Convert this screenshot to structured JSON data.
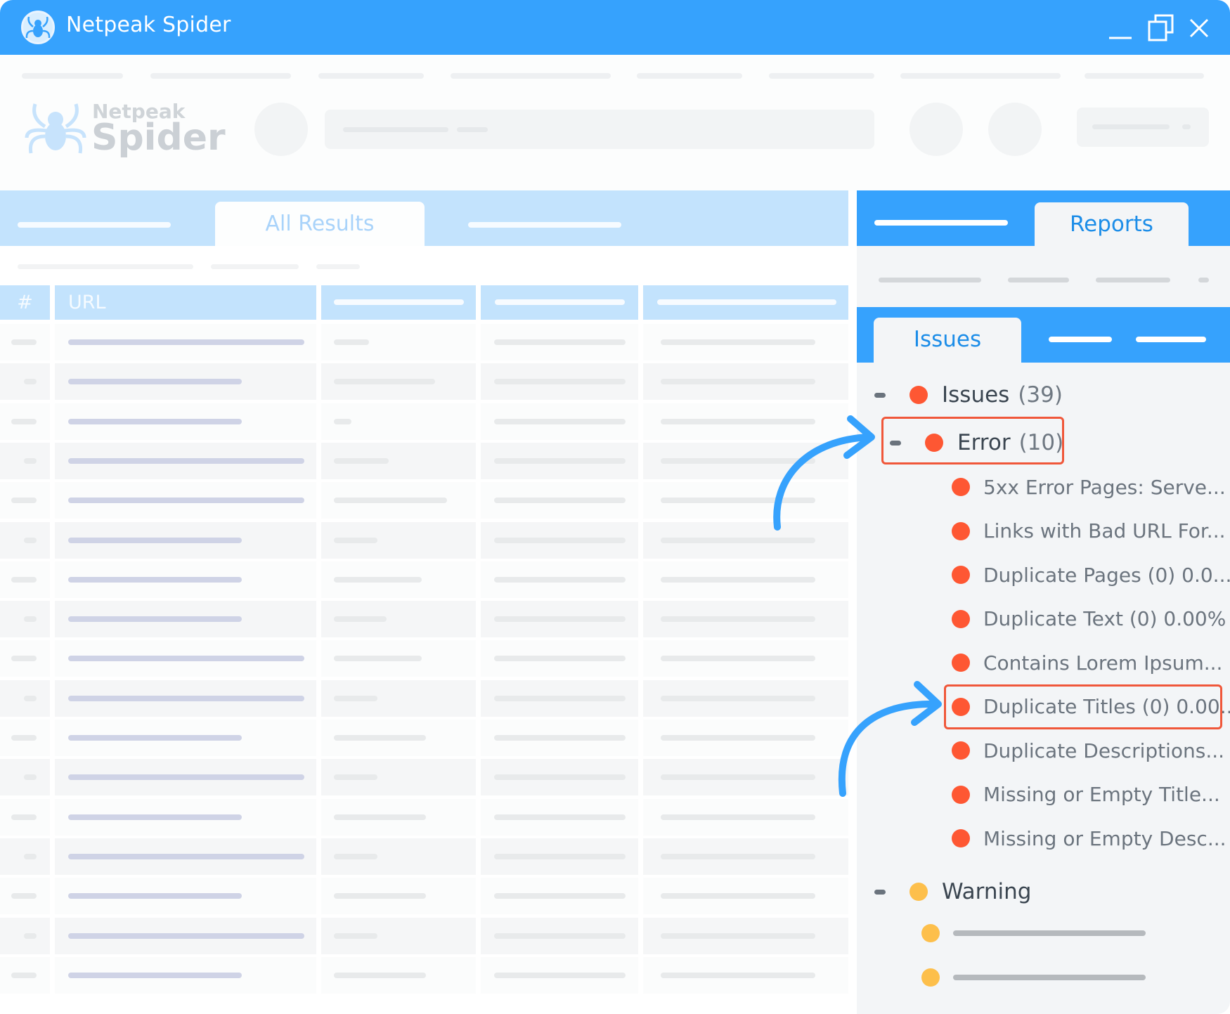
{
  "window": {
    "title": "Netpeak Spider",
    "controls": {
      "minimize": "minimize-icon",
      "maximize": "restore-icon",
      "close": "close-icon"
    }
  },
  "toolbar": {
    "logo_small": "Netpeak",
    "logo_big": "Spider"
  },
  "left_panel": {
    "active_tab": "All Results",
    "table": {
      "columns": [
        "#",
        "URL"
      ],
      "row_count_visible": 17
    }
  },
  "right_panel": {
    "active_tab": "Reports",
    "sub_tab": "Issues",
    "tree": {
      "root": {
        "label": "Issues",
        "count": "(39)",
        "color": "#fe5733"
      },
      "error": {
        "label": "Error",
        "count": "(10)",
        "color": "#fe5733",
        "highlighted": true
      },
      "error_children": [
        {
          "label": "5xx Error Pages: Serve...",
          "highlighted": false
        },
        {
          "label": "Links with Bad URL For...",
          "highlighted": false
        },
        {
          "label": "Duplicate Pages (0) 0.0...",
          "highlighted": false
        },
        {
          "label": "Duplicate Text (0) 0.00%",
          "highlighted": false
        },
        {
          "label": "Contains Lorem Ipsum...",
          "highlighted": false
        },
        {
          "label": "Duplicate Titles (0) 0.00...",
          "highlighted": true
        },
        {
          "label": "Duplicate Descriptions...",
          "highlighted": false
        },
        {
          "label": "Missing or Empty Title...",
          "highlighted": false
        },
        {
          "label": "Missing or Empty Desc...",
          "highlighted": false
        }
      ],
      "warning": {
        "label": "Warning",
        "color": "#fdbf4b"
      },
      "warning_children_placeholders": 2
    }
  },
  "colors": {
    "brand_blue": "#36a2fd",
    "error_red": "#fe5733",
    "warning_yellow": "#fdbf4b",
    "highlight_border": "#f0573a"
  }
}
